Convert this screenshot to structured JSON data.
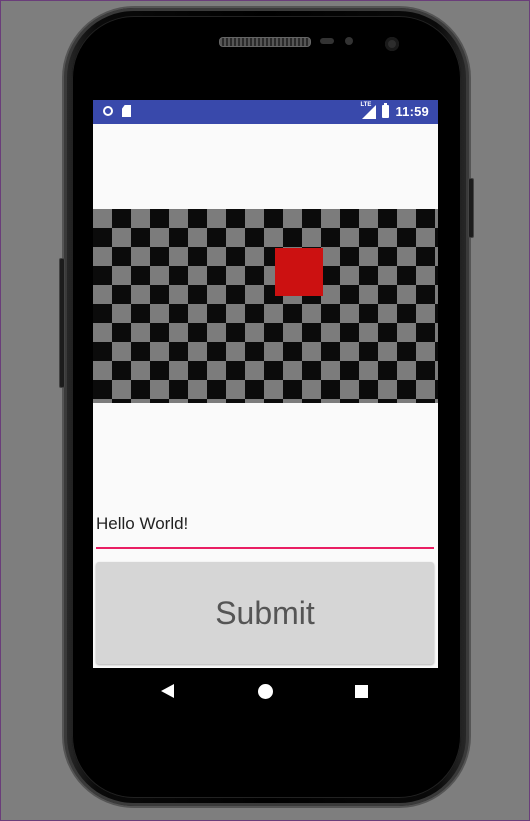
{
  "status_bar": {
    "time": "11:59",
    "network": "LTE",
    "background_color": "#3949ab",
    "icons": [
      "notification-circle-icon",
      "sd-card-icon",
      "lte-signal-icon",
      "battery-icon"
    ]
  },
  "game": {
    "board_colors": [
      "#0b0b0b",
      "#7c7c7c"
    ],
    "player_color": "#cc1111"
  },
  "text_field": {
    "value": "Hello World!",
    "underline_color": "#e91e63"
  },
  "submit": {
    "label": "Submit"
  },
  "nav_bar": {
    "icons": [
      "back-icon",
      "home-icon",
      "recent-apps-icon"
    ]
  }
}
